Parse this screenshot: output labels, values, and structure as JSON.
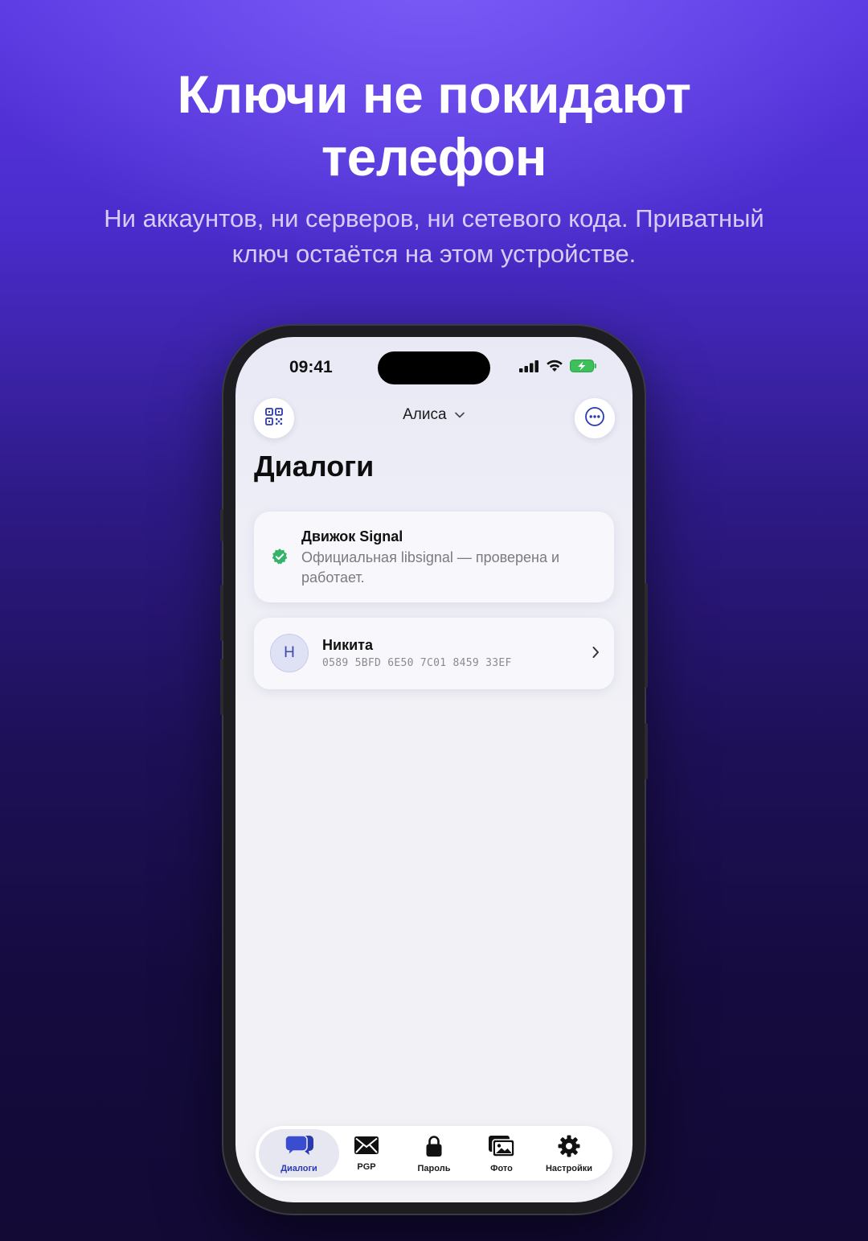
{
  "promo": {
    "headline_line1": "Ключи не покидают",
    "headline_line2": "телефон",
    "subline_line1": "Ни аккаунтов, ни серверов, ни сетевого кода. Приватный",
    "subline_line2": "ключ остаётся на этом устройстве."
  },
  "status_bar": {
    "time": "09:41",
    "icons": [
      "cellular-signal-icon",
      "wifi-icon",
      "battery-charging-icon"
    ]
  },
  "header": {
    "account_name": "Алиса",
    "left_icon": "qr-code-icon",
    "right_icon": "more-ellipsis-icon"
  },
  "page": {
    "title": "Диалоги"
  },
  "engine_card": {
    "title": "Движок Signal",
    "description": "Официальная libsignal — проверена и работает.",
    "icon": "verified-check-icon",
    "icon_color": "#34b36b"
  },
  "contacts": [
    {
      "initial": "Н",
      "name": "Никита",
      "fingerprint": "0589 5BFD 6E50 7C01 8459 33EF"
    }
  ],
  "tabs": [
    {
      "label": "Диалоги",
      "icon": "chat-bubbles-icon",
      "active": true
    },
    {
      "label": "PGP",
      "icon": "envelope-icon",
      "active": false
    },
    {
      "label": "Пароль",
      "icon": "lock-icon",
      "active": false
    },
    {
      "label": "Фото",
      "icon": "photos-icon",
      "active": false
    },
    {
      "label": "Настройки",
      "icon": "gear-icon",
      "active": false
    }
  ],
  "colors": {
    "accent": "#2a3bb0",
    "background_top": "#5a38e2",
    "background_bottom": "#130a36"
  }
}
